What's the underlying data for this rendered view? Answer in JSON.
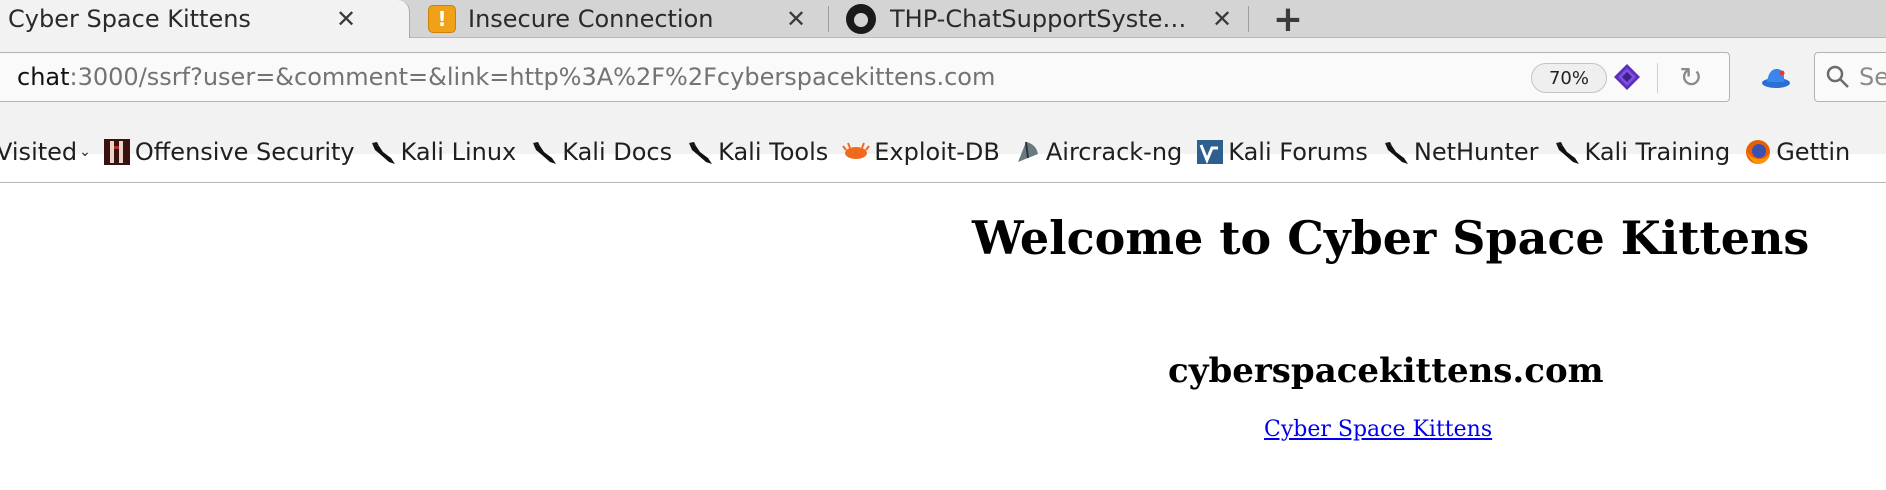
{
  "tabs": [
    {
      "title": "Cyber Space Kittens",
      "active": true,
      "favicon": "none"
    },
    {
      "title": "Insecure Connection",
      "active": false,
      "favicon": "warning-icon"
    },
    {
      "title": "THP-ChatSupportSyste…",
      "active": false,
      "favicon": "github-icon"
    }
  ],
  "tab_close_glyph": "✕",
  "new_tab_glyph": "+",
  "urlbar": {
    "host": "chat",
    "rest": ":3000/ssrf?user=&comment=&link=http%3A%2F%2Fcyberspacekittens.com",
    "zoom": "70%",
    "reload_glyph": "↻"
  },
  "search": {
    "placeholder": "Se"
  },
  "bookmarks": {
    "visited_label": "Visited",
    "items": [
      {
        "label": "Offensive Security",
        "icon": "offensive-security-icon"
      },
      {
        "label": "Kali Linux",
        "icon": "kali-dragon-icon"
      },
      {
        "label": "Kali Docs",
        "icon": "kali-dragon-icon"
      },
      {
        "label": "Kali Tools",
        "icon": "kali-dragon-icon"
      },
      {
        "label": "Exploit-DB",
        "icon": "exploit-db-icon"
      },
      {
        "label": "Aircrack-ng",
        "icon": "aircrack-icon"
      },
      {
        "label": "Kali Forums",
        "icon": "kali-forums-icon"
      },
      {
        "label": "NetHunter",
        "icon": "kali-dragon-icon"
      },
      {
        "label": "Kali Training",
        "icon": "kali-dragon-icon"
      },
      {
        "label": "Gettin",
        "icon": "firefox-icon"
      }
    ]
  },
  "page": {
    "heading": "Welcome to Cyber Space Kittens",
    "subheading": "cyberspacekittens.com",
    "link": "Cyber Space Kittens"
  },
  "colors": {
    "link": "#0000ee",
    "tabstrip": "#d4d4d4",
    "toolbar": "#f2f2f2",
    "warning_favicon": "#f1a117"
  }
}
